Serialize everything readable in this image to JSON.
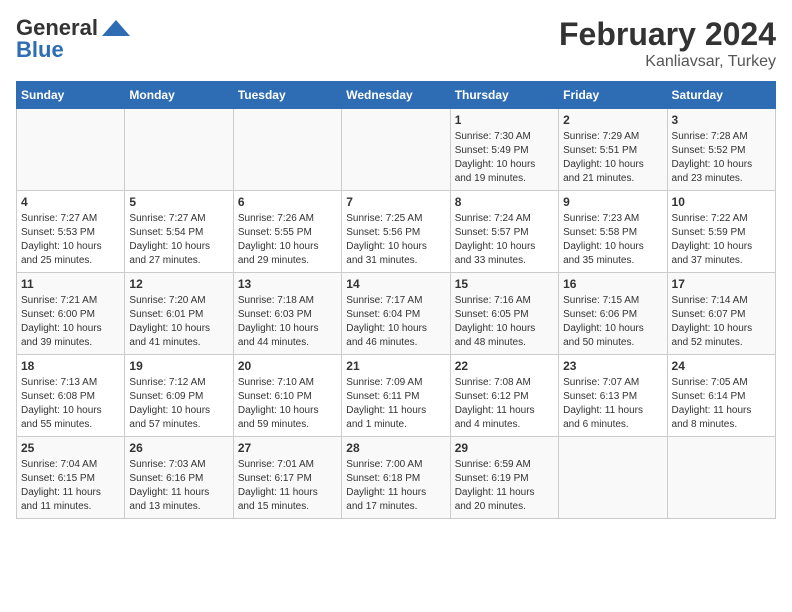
{
  "header": {
    "logo_general": "General",
    "logo_blue": "Blue",
    "title": "February 2024",
    "subtitle": "Kanliavsar, Turkey"
  },
  "days_of_week": [
    "Sunday",
    "Monday",
    "Tuesday",
    "Wednesday",
    "Thursday",
    "Friday",
    "Saturday"
  ],
  "weeks": [
    [
      {
        "day": "",
        "info": ""
      },
      {
        "day": "",
        "info": ""
      },
      {
        "day": "",
        "info": ""
      },
      {
        "day": "",
        "info": ""
      },
      {
        "day": "1",
        "info": "Sunrise: 7:30 AM\nSunset: 5:49 PM\nDaylight: 10 hours\nand 19 minutes."
      },
      {
        "day": "2",
        "info": "Sunrise: 7:29 AM\nSunset: 5:51 PM\nDaylight: 10 hours\nand 21 minutes."
      },
      {
        "day": "3",
        "info": "Sunrise: 7:28 AM\nSunset: 5:52 PM\nDaylight: 10 hours\nand 23 minutes."
      }
    ],
    [
      {
        "day": "4",
        "info": "Sunrise: 7:27 AM\nSunset: 5:53 PM\nDaylight: 10 hours\nand 25 minutes."
      },
      {
        "day": "5",
        "info": "Sunrise: 7:27 AM\nSunset: 5:54 PM\nDaylight: 10 hours\nand 27 minutes."
      },
      {
        "day": "6",
        "info": "Sunrise: 7:26 AM\nSunset: 5:55 PM\nDaylight: 10 hours\nand 29 minutes."
      },
      {
        "day": "7",
        "info": "Sunrise: 7:25 AM\nSunset: 5:56 PM\nDaylight: 10 hours\nand 31 minutes."
      },
      {
        "day": "8",
        "info": "Sunrise: 7:24 AM\nSunset: 5:57 PM\nDaylight: 10 hours\nand 33 minutes."
      },
      {
        "day": "9",
        "info": "Sunrise: 7:23 AM\nSunset: 5:58 PM\nDaylight: 10 hours\nand 35 minutes."
      },
      {
        "day": "10",
        "info": "Sunrise: 7:22 AM\nSunset: 5:59 PM\nDaylight: 10 hours\nand 37 minutes."
      }
    ],
    [
      {
        "day": "11",
        "info": "Sunrise: 7:21 AM\nSunset: 6:00 PM\nDaylight: 10 hours\nand 39 minutes."
      },
      {
        "day": "12",
        "info": "Sunrise: 7:20 AM\nSunset: 6:01 PM\nDaylight: 10 hours\nand 41 minutes."
      },
      {
        "day": "13",
        "info": "Sunrise: 7:18 AM\nSunset: 6:03 PM\nDaylight: 10 hours\nand 44 minutes."
      },
      {
        "day": "14",
        "info": "Sunrise: 7:17 AM\nSunset: 6:04 PM\nDaylight: 10 hours\nand 46 minutes."
      },
      {
        "day": "15",
        "info": "Sunrise: 7:16 AM\nSunset: 6:05 PM\nDaylight: 10 hours\nand 48 minutes."
      },
      {
        "day": "16",
        "info": "Sunrise: 7:15 AM\nSunset: 6:06 PM\nDaylight: 10 hours\nand 50 minutes."
      },
      {
        "day": "17",
        "info": "Sunrise: 7:14 AM\nSunset: 6:07 PM\nDaylight: 10 hours\nand 52 minutes."
      }
    ],
    [
      {
        "day": "18",
        "info": "Sunrise: 7:13 AM\nSunset: 6:08 PM\nDaylight: 10 hours\nand 55 minutes."
      },
      {
        "day": "19",
        "info": "Sunrise: 7:12 AM\nSunset: 6:09 PM\nDaylight: 10 hours\nand 57 minutes."
      },
      {
        "day": "20",
        "info": "Sunrise: 7:10 AM\nSunset: 6:10 PM\nDaylight: 10 hours\nand 59 minutes."
      },
      {
        "day": "21",
        "info": "Sunrise: 7:09 AM\nSunset: 6:11 PM\nDaylight: 11 hours\nand 1 minute."
      },
      {
        "day": "22",
        "info": "Sunrise: 7:08 AM\nSunset: 6:12 PM\nDaylight: 11 hours\nand 4 minutes."
      },
      {
        "day": "23",
        "info": "Sunrise: 7:07 AM\nSunset: 6:13 PM\nDaylight: 11 hours\nand 6 minutes."
      },
      {
        "day": "24",
        "info": "Sunrise: 7:05 AM\nSunset: 6:14 PM\nDaylight: 11 hours\nand 8 minutes."
      }
    ],
    [
      {
        "day": "25",
        "info": "Sunrise: 7:04 AM\nSunset: 6:15 PM\nDaylight: 11 hours\nand 11 minutes."
      },
      {
        "day": "26",
        "info": "Sunrise: 7:03 AM\nSunset: 6:16 PM\nDaylight: 11 hours\nand 13 minutes."
      },
      {
        "day": "27",
        "info": "Sunrise: 7:01 AM\nSunset: 6:17 PM\nDaylight: 11 hours\nand 15 minutes."
      },
      {
        "day": "28",
        "info": "Sunrise: 7:00 AM\nSunset: 6:18 PM\nDaylight: 11 hours\nand 17 minutes."
      },
      {
        "day": "29",
        "info": "Sunrise: 6:59 AM\nSunset: 6:19 PM\nDaylight: 11 hours\nand 20 minutes."
      },
      {
        "day": "",
        "info": ""
      },
      {
        "day": "",
        "info": ""
      }
    ]
  ]
}
